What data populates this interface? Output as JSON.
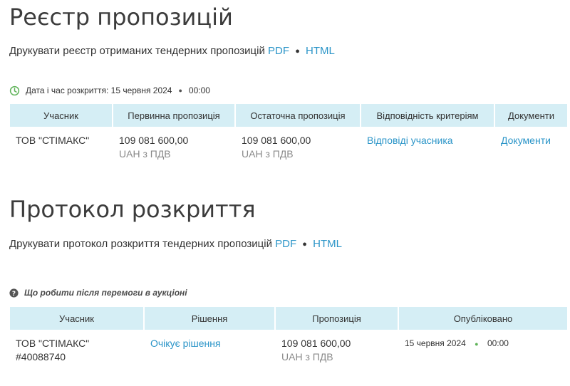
{
  "registry": {
    "title": "Реєстр пропозицій",
    "print_text": "Друкувати реєстр отриманих тендерних пропозицій",
    "pdf": "PDF",
    "html": "HTML",
    "opening_label": "Дата і час розкриття: 15 червня 2024",
    "opening_time": "00:00",
    "headers": [
      "Учасник",
      "Первинна пропозиція",
      "Остаточна пропозиція",
      "Відповідність критеріям",
      "Документи"
    ],
    "rows": [
      {
        "participant": "ТОВ \"СТІМАКС\"",
        "initial_amount": "109 081 600,00",
        "initial_currency": "UAH з ПДВ",
        "final_amount": "109 081 600,00",
        "final_currency": "UAH з ПДВ",
        "criteria_link": "Відповіді учасника",
        "documents_link": "Документи"
      }
    ]
  },
  "protocol": {
    "title": "Протокол розкриття",
    "print_text": "Друкувати протокол розкриття тендерних пропозицій",
    "pdf": "PDF",
    "html": "HTML",
    "faq": "Що робити після перемоги в аукціоні",
    "headers": [
      "Учасник",
      "Рішення",
      "Пропозиція",
      "Опубліковано"
    ],
    "rows": [
      {
        "participant": "ТОВ \"СТІМАКС\"",
        "code": "#40088740",
        "decision": "Очікує рішення",
        "amount": "109 081 600,00",
        "currency": "UAH з ПДВ",
        "published_date": "15 червня 2024",
        "published_time": "00:00"
      }
    ]
  },
  "colors": {
    "link": "#2b95c8",
    "header_bg": "#d5eef5",
    "clock_icon": "#5fb359"
  }
}
